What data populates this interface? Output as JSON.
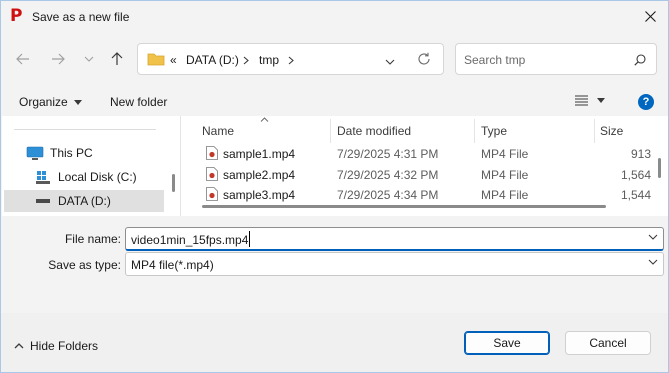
{
  "window": {
    "title": "Save as a new file",
    "app_icon_glyph": "P"
  },
  "address": {
    "chevron_prefix": "«",
    "drive": "DATA (D:)",
    "folder": "tmp"
  },
  "search": {
    "placeholder": "Search tmp"
  },
  "toolbar": {
    "organize_label": "Organize",
    "new_folder_label": "New folder"
  },
  "nav_tree": [
    {
      "label": "This PC",
      "icon": "computer-icon"
    },
    {
      "label": "Local Disk (C:)",
      "icon": "windows-drive-icon"
    },
    {
      "label": "DATA (D:)",
      "icon": "drive-icon",
      "selected": true
    }
  ],
  "columns": {
    "name": "Name",
    "date": "Date modified",
    "type": "Type",
    "size": "Size"
  },
  "files": [
    {
      "name": "sample1.mp4",
      "date": "7/29/2025 4:31 PM",
      "type": "MP4 File",
      "size": "913"
    },
    {
      "name": "sample2.mp4",
      "date": "7/29/2025 4:32 PM",
      "type": "MP4 File",
      "size": "1,564"
    },
    {
      "name": "sample3.mp4",
      "date": "7/29/2025 4:34 PM",
      "type": "MP4 File",
      "size": "1,544"
    }
  ],
  "form": {
    "file_name_label": "File name:",
    "file_name_value": "video1min_15fps.mp4",
    "save_type_label": "Save as type:",
    "save_type_value": "MP4 file(*.mp4)"
  },
  "footer": {
    "hide_folders_label": "Hide Folders",
    "save_label": "Save",
    "cancel_label": "Cancel"
  },
  "colors": {
    "accent": "#005fb8",
    "app_icon": "#d01010",
    "help_icon": "#0067c0",
    "folder": "#f0c24a"
  }
}
